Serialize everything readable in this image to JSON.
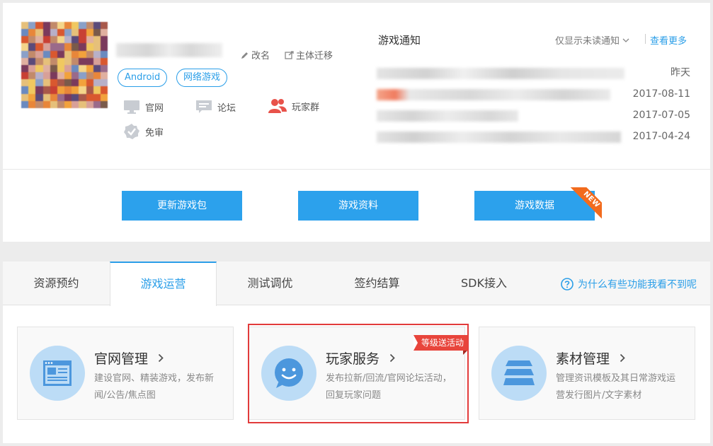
{
  "header": {
    "rename_label": "改名",
    "migrate_label": "主体迁移",
    "tags": [
      "Android",
      "网络游戏"
    ],
    "links": {
      "website": "官网",
      "forum": "论坛",
      "player_group": "玩家群",
      "free_review": "免审"
    }
  },
  "notices": {
    "title": "游戏通知",
    "filter_label": "仅显示未读通知",
    "more_label": "查看更多",
    "items": [
      {
        "date": "昨天"
      },
      {
        "date": "2017-08-11"
      },
      {
        "date": "2017-07-05"
      },
      {
        "date": "2017-04-24"
      }
    ]
  },
  "actions": {
    "update_package": "更新游戏包",
    "game_info": "游戏资料",
    "game_data": "游戏数据",
    "new_badge": "NEW"
  },
  "tabs": [
    {
      "label": "资源预约"
    },
    {
      "label": "游戏运营"
    },
    {
      "label": "测试调优"
    },
    {
      "label": "签约结算"
    },
    {
      "label": "SDK接入"
    }
  ],
  "help_link": "为什么有些功能我看不到呢",
  "features": [
    {
      "title": "官网管理",
      "desc": "建设官网、精装游戏，发布新闻/公告/焦点图"
    },
    {
      "title": "玩家服务",
      "desc": "发布拉新/回流/官网论坛活动，回复玩家问题",
      "badge": "等级送活动"
    },
    {
      "title": "素材管理",
      "desc": "管理资讯模板及其日常游戏运营发行图片/文字素材"
    }
  ],
  "colors": {
    "accent": "#2ca1ec",
    "link": "#2a9ee8",
    "highlight": "#e23b3b",
    "badge": "#e8453c",
    "new_badge": "#f26b1d"
  }
}
